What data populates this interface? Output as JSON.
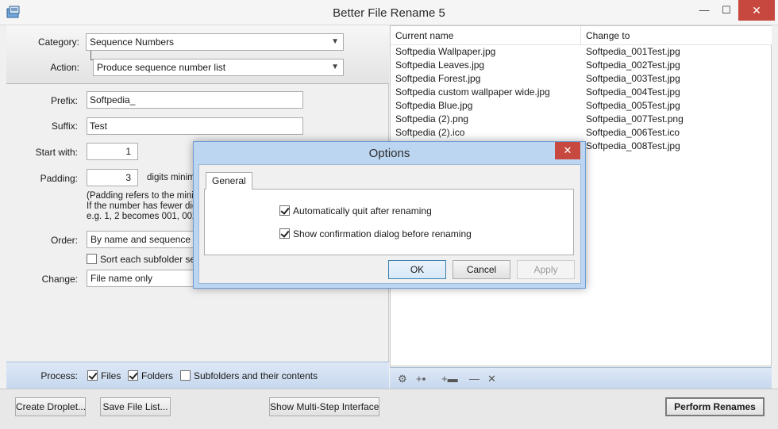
{
  "window": {
    "title": "Better File Rename 5",
    "min_glyph": "—",
    "max_glyph": "☐",
    "close_glyph": "✕"
  },
  "top": {
    "category_label": "Category:",
    "category_value": "Sequence Numbers",
    "action_label": "Action:",
    "action_value": "Produce sequence number list"
  },
  "settings": {
    "prefix_label": "Prefix:",
    "prefix_value": "Softpedia_",
    "suffix_label": "Suffix:",
    "suffix_value": "Test",
    "start_label": "Start with:",
    "start_value": "1",
    "padding_label": "Padding:",
    "padding_value": "3",
    "padding_suffix": "digits minimu",
    "padding_note_1": "(Padding refers to the minimu",
    "padding_note_2": "If the number has fewer digit",
    "padding_note_3": "e.g. 1, 2 becomes 001, 002)",
    "order_label": "Order:",
    "order_value": "By name and sequence num",
    "sort_subfolder_label": "Sort each subfolder sepa",
    "sort_subfolder_checked": false,
    "change_label": "Change:",
    "change_value": "File name only"
  },
  "process": {
    "label": "Process:",
    "files_label": "Files",
    "files_checked": true,
    "folders_label": "Folders",
    "folders_checked": true,
    "subfolders_label": "Subfolders and their contents",
    "subfolders_checked": false
  },
  "list": {
    "col_current": "Current name",
    "col_change": "Change to",
    "rows": [
      {
        "current": "Softpedia Wallpaper.jpg",
        "change": "Softpedia_001Test.jpg"
      },
      {
        "current": "Softpedia Leaves.jpg",
        "change": "Softpedia_002Test.jpg"
      },
      {
        "current": "Softpedia Forest.jpg",
        "change": "Softpedia_003Test.jpg"
      },
      {
        "current": "Softpedia custom wallpaper wide.jpg",
        "change": "Softpedia_004Test.jpg"
      },
      {
        "current": "Softpedia Blue.jpg",
        "change": "Softpedia_005Test.jpg"
      },
      {
        "current": "Softpedia (2).png",
        "change": "Softpedia_007Test.png"
      },
      {
        "current": "Softpedia (2).ico",
        "change": "Softpedia_006Test.ico"
      },
      {
        "current": "",
        "change": "Softpedia_008Test.jpg"
      }
    ]
  },
  "toolbar": {
    "settings_glyph": "⚙",
    "add_file_glyph": "+▪",
    "add_folder_glyph": "+▬",
    "remove_glyph": "—",
    "clear_glyph": "✕"
  },
  "buttons": {
    "create_droplet": "Create Droplet...",
    "save_file_list": "Save File List...",
    "show_multistep": "Show Multi-Step Interface",
    "perform_renames": "Perform Renames"
  },
  "dialog": {
    "title": "Options",
    "close_glyph": "✕",
    "tab_general": "General",
    "opt_auto_quit": "Automatically quit after renaming",
    "opt_auto_quit_checked": true,
    "opt_confirm": "Show confirmation dialog before renaming",
    "opt_confirm_checked": true,
    "ok": "OK",
    "cancel": "Cancel",
    "apply": "Apply"
  }
}
